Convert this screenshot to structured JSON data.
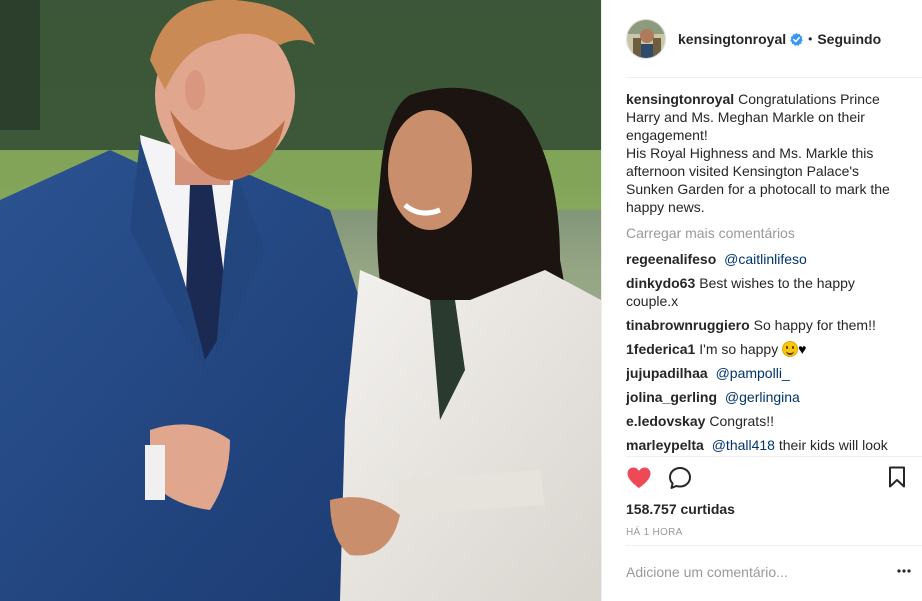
{
  "header": {
    "username": "kensingtonroyal",
    "dot": "•",
    "follow_label": "Seguindo"
  },
  "caption": {
    "username": "kensingtonroyal",
    "lines": [
      "Congratulations Prince",
      "Harry and Ms. Meghan Markle on their",
      "engagement!",
      "His Royal Highness and Ms. Markle this",
      "afternoon visited Kensington Palace's",
      "Sunken Garden for a photocall to mark the",
      "happy news."
    ]
  },
  "load_more_label": "Carregar mais comentários",
  "comments": [
    {
      "user": "regeenalifeso",
      "mention": "@caitlinlifeso",
      "text": ""
    },
    {
      "user": "dinkydo63",
      "mention": "",
      "text": "Best wishes to the happy couple.x"
    },
    {
      "user": "tinabrownruggiero",
      "mention": "",
      "text": "So happy for them!!"
    },
    {
      "user": "1federica1",
      "mention": "",
      "text": "I'm so happy",
      "heart": "♥"
    },
    {
      "user": "jujupadilhaa",
      "mention": "@pampolli_",
      "text": ""
    },
    {
      "user": "jolina_gerling",
      "mention": "@gerlingina",
      "text": ""
    },
    {
      "user": "e.ledovskay",
      "mention": "",
      "text": "Congrats!!"
    },
    {
      "user": "marleypelta",
      "mention": "@thall418",
      "text": "their kids will look"
    }
  ],
  "icons": {
    "like": "heart-icon",
    "comment": "comment-icon",
    "save": "bookmark-icon",
    "verified": "verified-badge-icon",
    "more": "more-options-icon"
  },
  "colors": {
    "like_red": "#ed4956",
    "verified_blue": "#3897f0",
    "mention_blue": "#003569",
    "muted_gray": "#999999"
  },
  "likes_label": "158.757 curtidas",
  "time_label": "HÁ 1 HORA",
  "add_comment_placeholder": "Adicione um comentário..."
}
